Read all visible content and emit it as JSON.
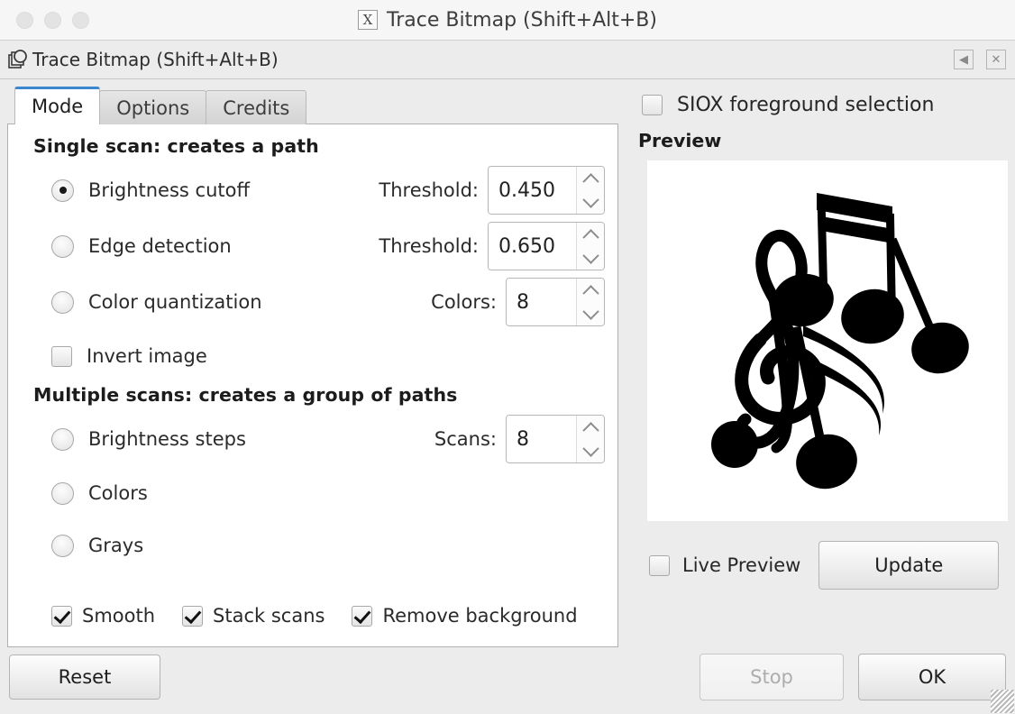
{
  "os_window": {
    "title": "Trace Bitmap (Shift+Alt+B)",
    "app_glyph": "X",
    "traffic_lights": [
      "close-button",
      "minimize-button",
      "maximize-button"
    ]
  },
  "app": {
    "title": "Trace Bitmap (Shift+Alt+B)",
    "icon_name": "trace-bitmap-icon",
    "titlebar_buttons": [
      {
        "name": "collapse-button",
        "glyph": "◀"
      },
      {
        "name": "close-button",
        "glyph": "✕"
      }
    ]
  },
  "tabs": [
    {
      "label": "Mode",
      "active": true
    },
    {
      "label": "Options",
      "active": false
    },
    {
      "label": "Credits",
      "active": false
    }
  ],
  "mode_tab": {
    "single_scan_heading": "Single scan: creates a path",
    "single_scan_options": [
      {
        "label": "Brightness cutoff",
        "selected": true,
        "field_label": "Threshold:",
        "field_value": "0.450",
        "field_kind": "spinner"
      },
      {
        "label": "Edge detection",
        "selected": false,
        "field_label": "Threshold:",
        "field_value": "0.650",
        "field_kind": "spinner"
      },
      {
        "label": "Color quantization",
        "selected": false,
        "field_label": "Colors:",
        "field_value": "8",
        "field_kind": "spinner"
      }
    ],
    "invert_image": {
      "label": "Invert image",
      "checked": false
    },
    "multi_scan_heading": "Multiple scans: creates a group of paths",
    "multi_scan_options": [
      {
        "label": "Brightness steps",
        "selected": false,
        "field_label": "Scans:",
        "field_value": "8",
        "field_kind": "spinner"
      },
      {
        "label": "Colors",
        "selected": false,
        "field_label": "",
        "field_value": "",
        "field_kind": "none"
      },
      {
        "label": "Grays",
        "selected": false,
        "field_label": "",
        "field_value": "",
        "field_kind": "none"
      }
    ],
    "bottom_checkboxes": [
      {
        "label": "Smooth",
        "checked": true
      },
      {
        "label": "Stack scans",
        "checked": true
      },
      {
        "label": "Remove background",
        "checked": true
      }
    ]
  },
  "right_panel": {
    "siox": {
      "label": "SIOX foreground selection",
      "checked": false
    },
    "preview_title": "Preview",
    "preview_image_name": "music-notes-preview",
    "live_preview": {
      "label": "Live Preview",
      "checked": false
    },
    "update_button": "Update"
  },
  "footer": {
    "reset_button": "Reset",
    "stop_button": "Stop",
    "stop_disabled": true,
    "ok_button": "OK"
  },
  "colors": {
    "accent": "#3b87d0",
    "window_bg": "#ececec",
    "panel_bg": "#ffffff",
    "preview_bg": "#ffffff",
    "preview_ink": "#000000",
    "text": "#2a2a2a",
    "disabled_text": "#adadad"
  }
}
